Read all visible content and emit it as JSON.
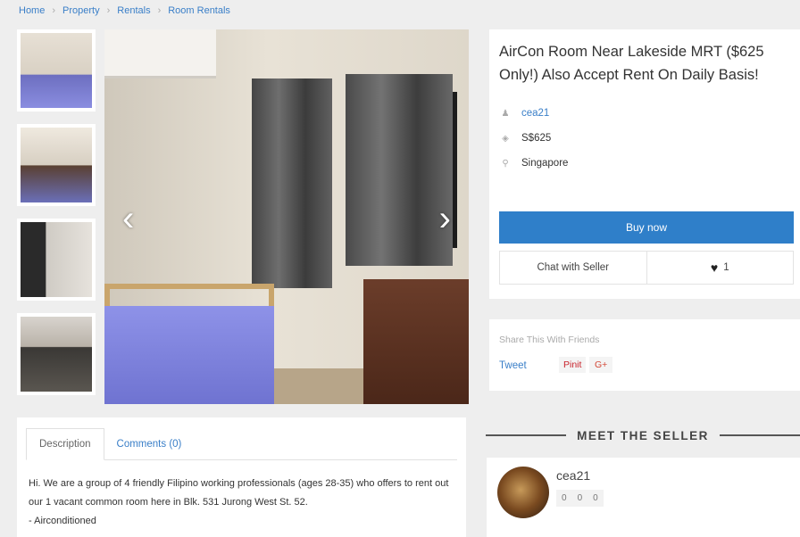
{
  "breadcrumb": [
    "Home",
    "Property",
    "Rentals",
    "Room Rentals"
  ],
  "listing": {
    "title": "AirCon Room Near Lakeside MRT ($625 Only!) Also Accept Rent On Daily Basis!",
    "seller": "cea21",
    "price": "S$625",
    "location": "Singapore"
  },
  "icons": {
    "seller": "user-icon",
    "price": "tag-icon",
    "location": "map-pin-icon",
    "prev": "chevron-left-icon",
    "next": "chevron-right-icon",
    "like": "heart-icon"
  },
  "buttons": {
    "buy": "Buy now",
    "chat": "Chat with Seller",
    "likes": "1"
  },
  "share": {
    "title": "Share This With Friends",
    "tweet": "Tweet",
    "pin": "Pinit",
    "gplus": "G+"
  },
  "meet": {
    "label": "MEET THE SELLER"
  },
  "seller_card": {
    "name": "cea21",
    "ratings": [
      "0",
      "0",
      "0"
    ]
  },
  "tabs": [
    "Description",
    "Comments (0)"
  ],
  "description": [
    "Hi. We are a group of 4 friendly Filipino working professionals (ages 28-35) who offers to rent out our 1 vacant common room here in Blk. 531 Jurong West St. 52.",
    "- Airconditioned"
  ],
  "colors": {
    "accent": "#2f7fc9",
    "link": "#3a7fc8"
  }
}
